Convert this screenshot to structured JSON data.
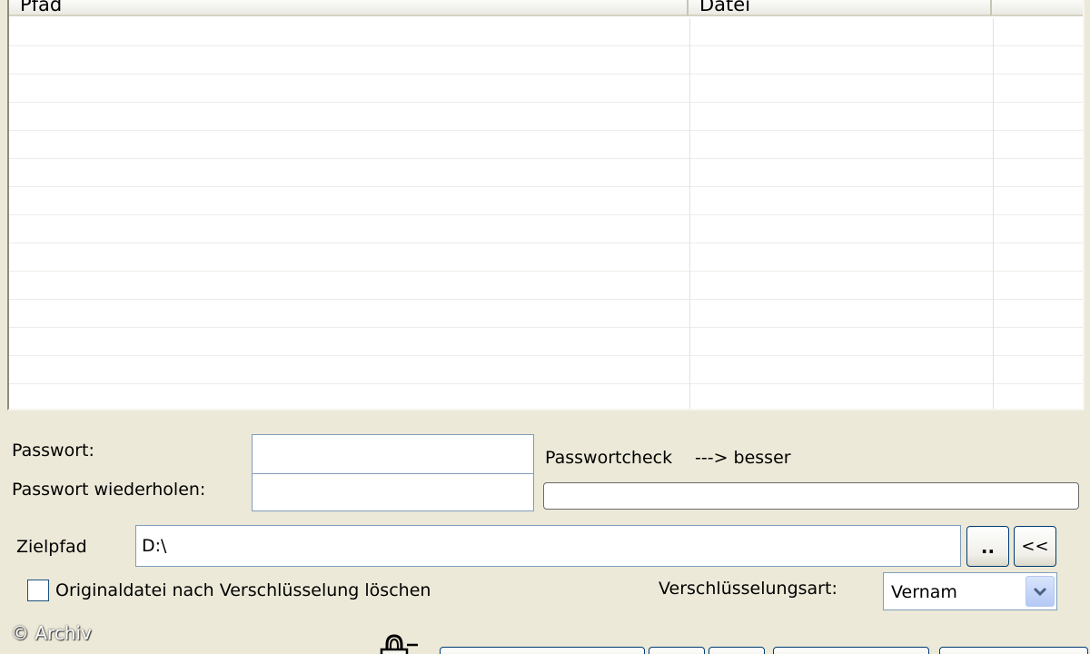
{
  "file_list": {
    "columns": [
      {
        "label": "Pfad"
      },
      {
        "label": "Datei"
      },
      {
        "label": ""
      }
    ],
    "rows": []
  },
  "password": {
    "label": "Passwort:",
    "value": ""
  },
  "password_repeat": {
    "label": "Passwort wiederholen:",
    "value": ""
  },
  "password_check": {
    "label": "Passwortcheck",
    "hint": "---> besser",
    "strength": 0
  },
  "target_path": {
    "label": "Zielpfad",
    "value": "D:\\",
    "browse_label": "..",
    "back_label": "<<"
  },
  "delete_original": {
    "label": "Originaldatei nach Verschlüsselung löschen",
    "checked": false
  },
  "encryption": {
    "label": "Verschlüsselungsart:",
    "selected": "Vernam"
  },
  "watermark": "© Archiv",
  "icons": {
    "dropdown": "chevron-down-icon",
    "lock": "lock-icon"
  },
  "colors": {
    "window_bg": "#ece9d8",
    "input_border": "#7f9db9",
    "button_border": "#003c74"
  }
}
